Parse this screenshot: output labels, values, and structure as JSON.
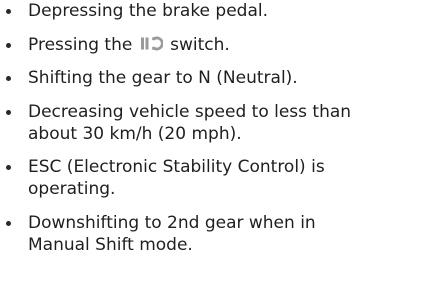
{
  "items": [
    {
      "lines": [
        "Depressing the brake pedal."
      ]
    },
    {
      "before_icon": "Pressing the",
      "icon": "auto-stop-hold-switch-icon",
      "after_icon": "switch."
    },
    {
      "lines": [
        "Shifting the gear to N (Neutral)."
      ]
    },
    {
      "lines": [
        "Decreasing vehicle speed to less than",
        "about 30 km/h (20 mph)."
      ]
    },
    {
      "lines": [
        "ESC (Electronic Stability Control) is",
        "operating."
      ]
    },
    {
      "lines": [
        "Downshifting to 2nd gear when in",
        "Manual Shift mode."
      ]
    }
  ]
}
